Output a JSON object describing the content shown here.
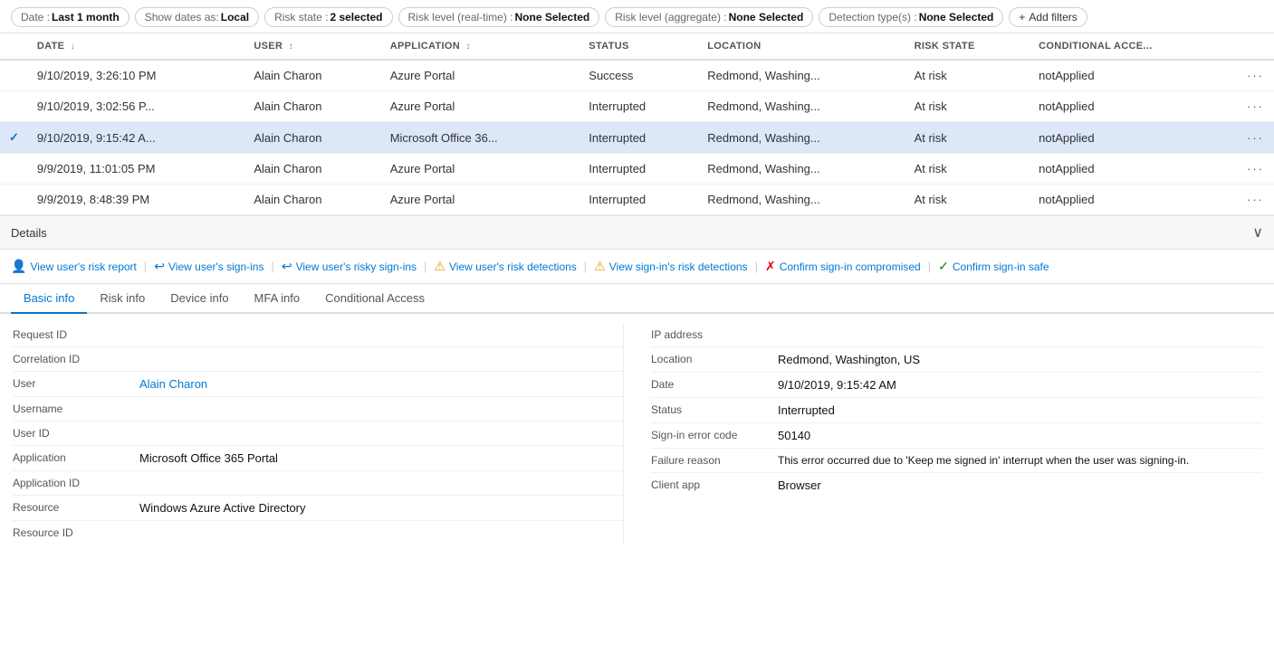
{
  "filters": {
    "date": {
      "key": "Date : ",
      "val": "Last 1 month"
    },
    "show_dates": {
      "key": "Show dates as: ",
      "val": "Local"
    },
    "risk_state": {
      "key": "Risk state : ",
      "val": "2 selected"
    },
    "risk_level_realtime": {
      "key": "Risk level (real-time) : ",
      "val": "None Selected"
    },
    "risk_level_aggregate": {
      "key": "Risk level (aggregate) : ",
      "val": "None Selected"
    },
    "detection_types": {
      "key": "Detection type(s) : ",
      "val": "None Selected"
    },
    "add_filters_label": "+ Add filters"
  },
  "table": {
    "columns": [
      {
        "id": "date",
        "label": "DATE",
        "sortable": true
      },
      {
        "id": "user",
        "label": "USER",
        "sortable": true
      },
      {
        "id": "application",
        "label": "APPLICATION",
        "sortable": true
      },
      {
        "id": "status",
        "label": "STATUS",
        "sortable": false
      },
      {
        "id": "location",
        "label": "LOCATION",
        "sortable": false
      },
      {
        "id": "risk_state",
        "label": "RISK STATE",
        "sortable": false
      },
      {
        "id": "conditional_access",
        "label": "CONDITIONAL ACCE...",
        "sortable": false
      }
    ],
    "rows": [
      {
        "selected": false,
        "date": "9/10/2019, 3:26:10 PM",
        "user": "Alain Charon",
        "application": "Azure Portal",
        "status": "Success",
        "location": "Redmond, Washing...",
        "risk_state": "At risk",
        "conditional_access": "notApplied"
      },
      {
        "selected": false,
        "date": "9/10/2019, 3:02:56 P...",
        "user": "Alain Charon",
        "application": "Azure Portal",
        "status": "Interrupted",
        "location": "Redmond, Washing...",
        "risk_state": "At risk",
        "conditional_access": "notApplied"
      },
      {
        "selected": true,
        "date": "9/10/2019, 9:15:42 A...",
        "user": "Alain Charon",
        "application": "Microsoft Office 36...",
        "status": "Interrupted",
        "location": "Redmond, Washing...",
        "risk_state": "At risk",
        "conditional_access": "notApplied"
      },
      {
        "selected": false,
        "date": "9/9/2019, 11:01:05 PM",
        "user": "Alain Charon",
        "application": "Azure Portal",
        "status": "Interrupted",
        "location": "Redmond, Washing...",
        "risk_state": "At risk",
        "conditional_access": "notApplied"
      },
      {
        "selected": false,
        "date": "9/9/2019, 8:48:39 PM",
        "user": "Alain Charon",
        "application": "Azure Portal",
        "status": "Interrupted",
        "location": "Redmond, Washing...",
        "risk_state": "At risk",
        "conditional_access": "notApplied"
      }
    ]
  },
  "details_bar": {
    "label": "Details"
  },
  "action_links": [
    {
      "id": "view-risk-report",
      "icon": "👤",
      "label": "View user's risk report"
    },
    {
      "id": "view-sign-ins",
      "icon": "↩",
      "label": "View user's sign-ins"
    },
    {
      "id": "view-risky-sign-ins",
      "icon": "↩",
      "label": "View user's risky sign-ins"
    },
    {
      "id": "view-risk-detections",
      "icon": "⚠",
      "label": "View user's risk detections"
    },
    {
      "id": "view-signin-risk",
      "icon": "⚠",
      "label": "View sign-in's risk detections"
    },
    {
      "id": "confirm-compromised",
      "icon": "✗",
      "label": "Confirm sign-in compromised"
    },
    {
      "id": "confirm-safe",
      "icon": "✓",
      "label": "Confirm sign-in safe"
    }
  ],
  "tabs": [
    {
      "id": "basic-info",
      "label": "Basic info",
      "active": true
    },
    {
      "id": "risk-info",
      "label": "Risk info",
      "active": false
    },
    {
      "id": "device-info",
      "label": "Device info",
      "active": false
    },
    {
      "id": "mfa-info",
      "label": "MFA info",
      "active": false
    },
    {
      "id": "conditional-access",
      "label": "Conditional Access",
      "active": false
    }
  ],
  "basic_info": {
    "left": [
      {
        "label": "Request ID",
        "value": ""
      },
      {
        "label": "Correlation ID",
        "value": ""
      },
      {
        "label": "User",
        "value": "Alain Charon",
        "is_link": true
      },
      {
        "label": "Username",
        "value": ""
      },
      {
        "label": "User ID",
        "value": ""
      },
      {
        "label": "Application",
        "value": "Microsoft Office 365 Portal"
      },
      {
        "label": "Application ID",
        "value": ""
      },
      {
        "label": "Resource",
        "value": "Windows Azure Active Directory"
      },
      {
        "label": "Resource ID",
        "value": ""
      }
    ],
    "right": [
      {
        "label": "IP address",
        "value": ""
      },
      {
        "label": "Location",
        "value": "Redmond, Washington, US"
      },
      {
        "label": "Date",
        "value": "9/10/2019, 9:15:42 AM"
      },
      {
        "label": "Status",
        "value": "Interrupted"
      },
      {
        "label": "Sign-in error code",
        "value": "50140"
      },
      {
        "label": "Failure reason",
        "value": "This error occurred due to 'Keep me signed in' interrupt when the user was signing-in."
      },
      {
        "label": "Client app",
        "value": "Browser"
      }
    ]
  }
}
